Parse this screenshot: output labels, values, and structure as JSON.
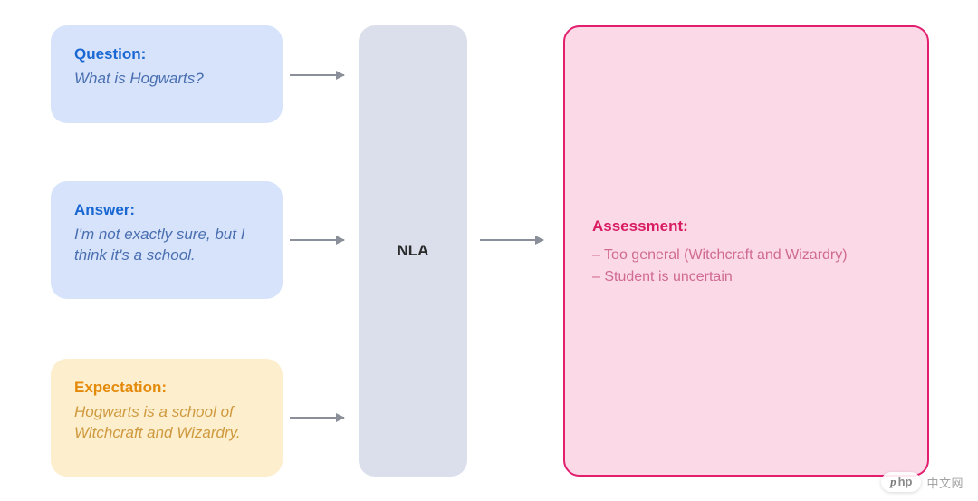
{
  "question": {
    "title": "Question:",
    "body": "What is Hogwarts?"
  },
  "answer": {
    "title": "Answer:",
    "body": "I'm not exactly sure, but I think it's a school."
  },
  "expectation": {
    "title": "Expectation:",
    "body": "Hogwarts is a school of Witchcraft and Wizardry."
  },
  "processor": {
    "label": "NLA"
  },
  "assessment": {
    "title": "Assessment:",
    "items": [
      "– Too general (Witchcraft and Wizardry)",
      "– Student is uncertain"
    ]
  },
  "watermark": {
    "brand_prefix": "p",
    "brand_suffix": "hp",
    "tail": "中文网"
  }
}
